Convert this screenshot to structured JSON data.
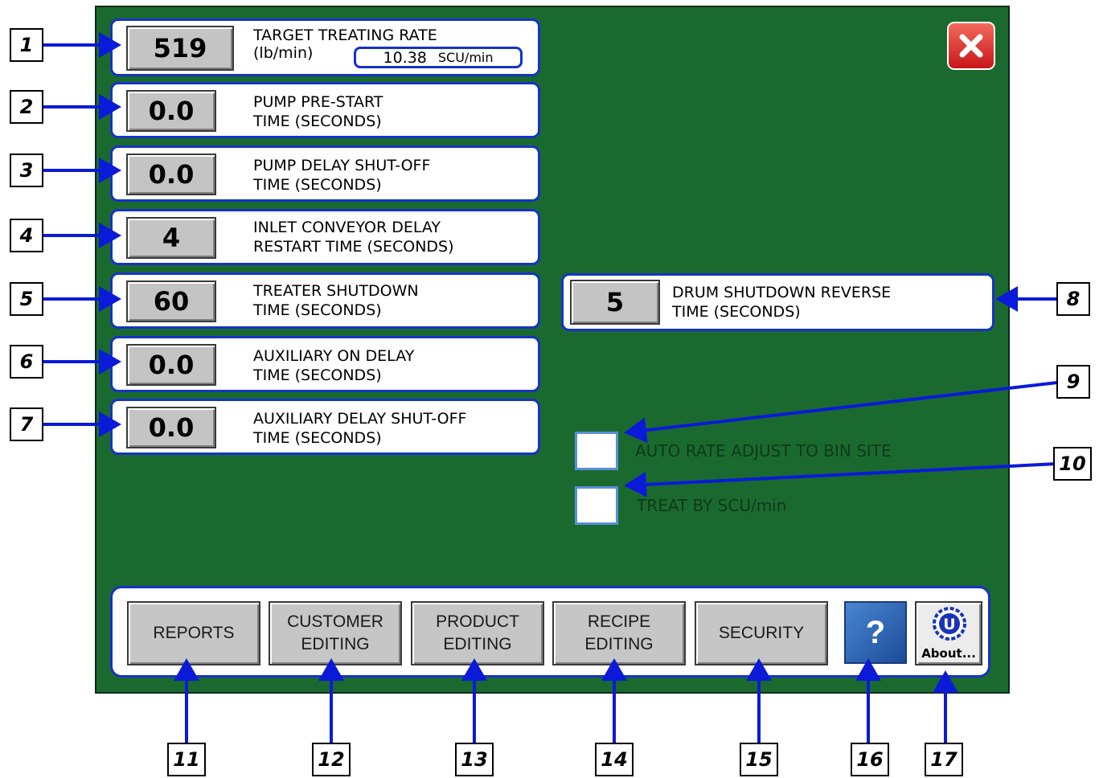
{
  "settings": [
    {
      "value": "519",
      "label": "TARGET TREATING RATE\n(lb/min)"
    },
    {
      "value": "0.0",
      "label": "PUMP PRE-START\nTIME (SECONDS)"
    },
    {
      "value": "0.0",
      "label": "PUMP DELAY SHUT-OFF\nTIME (SECONDS)"
    },
    {
      "value": "4",
      "label": "INLET CONVEYOR DELAY\nRESTART TIME (SECONDS)"
    },
    {
      "value": "60",
      "label": "TREATER SHUTDOWN\nTIME (SECONDS)"
    },
    {
      "value": "0.0",
      "label": "AUXILIARY ON DELAY\nTIME (SECONDS)"
    },
    {
      "value": "0.0",
      "label": "AUXILIARY DELAY SHUT-OFF\nTIME (SECONDS)"
    }
  ],
  "scu_rate": {
    "value": "10.38",
    "unit": "SCU/min"
  },
  "drum": {
    "value": "5",
    "label": "DRUM SHUTDOWN REVERSE\nTIME (SECONDS)"
  },
  "checkboxes": [
    {
      "label": "AUTO RATE ADJUST TO BIN SITE",
      "checked": false
    },
    {
      "label": "TREAT BY SCU/min",
      "checked": false
    }
  ],
  "nav": {
    "reports": "REPORTS",
    "customer": "CUSTOMER\nEDITING",
    "product": "PRODUCT\nEDITING",
    "recipe": "RECIPE\nEDITING",
    "security": "SECURITY",
    "help": "?",
    "about": "About...",
    "about_logo": "U"
  },
  "callouts": [
    "1",
    "2",
    "3",
    "4",
    "5",
    "6",
    "7",
    "8",
    "9",
    "10",
    "11",
    "12",
    "13",
    "14",
    "15",
    "16",
    "17"
  ],
  "icons": {
    "close": "close-x-icon",
    "help": "question-icon",
    "about": "u-logo-icon"
  },
  "colors": {
    "screen": "#1a6a30",
    "panel_border": "#1533c4",
    "callout_arrow": "#0a1ad8",
    "close_button": "#d9232a"
  }
}
